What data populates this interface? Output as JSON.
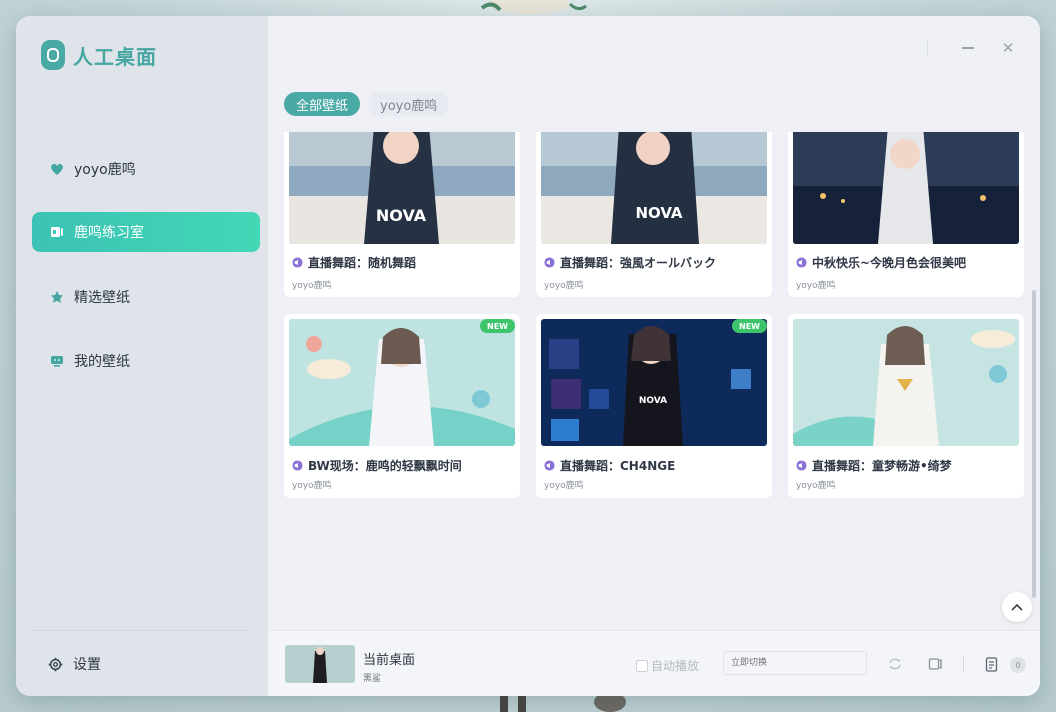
{
  "app": {
    "name": "人工桌面"
  },
  "sidebar": {
    "items": [
      {
        "label": "yoyo鹿鸣",
        "icon": "heart-icon"
      },
      {
        "label": "鹿鸣练习室",
        "icon": "speaker-icon",
        "active": true
      },
      {
        "label": "精选壁纸",
        "icon": "star-icon"
      },
      {
        "label": "我的壁纸",
        "icon": "monitor-icon"
      }
    ],
    "settings_label": "设置"
  },
  "tabs": [
    {
      "label": "全部壁纸",
      "active": true
    },
    {
      "label": "yoyo鹿鸣",
      "active": false
    }
  ],
  "cards": [
    {
      "title": "直播舞蹈：随机舞蹈",
      "author": "yoyo鹿鸣",
      "is_new": false
    },
    {
      "title": "直播舞蹈：強風オールバック",
      "author": "yoyo鹿鸣",
      "is_new": false
    },
    {
      "title": "中秋快乐~今晚月色会很美吧",
      "author": "yoyo鹿鸣",
      "is_new": false
    },
    {
      "title": "BW现场：鹿鸣的轻飘飘时间",
      "author": "yoyo鹿鸣",
      "is_new": true,
      "badge": "NEW"
    },
    {
      "title": "直播舞蹈：CH4NGE",
      "author": "yoyo鹿鸣",
      "is_new": true,
      "badge": "NEW"
    },
    {
      "title": "直播舞蹈：童梦畅游•绮梦",
      "author": "yoyo鹿鸣",
      "is_new": false
    }
  ],
  "player": {
    "title": "当前桌面",
    "subtitle": "黑鲨",
    "autoplay_label": "自动播放",
    "input_placeholder": "立即切换",
    "playlist_count": "0"
  },
  "colors": {
    "accent": "#49a9a5",
    "active_gradient_start": "#3cc2b4",
    "active_gradient_end": "#43d8b6",
    "new_badge": "#3ec56c",
    "sound_icon": "#8a6fd8"
  }
}
